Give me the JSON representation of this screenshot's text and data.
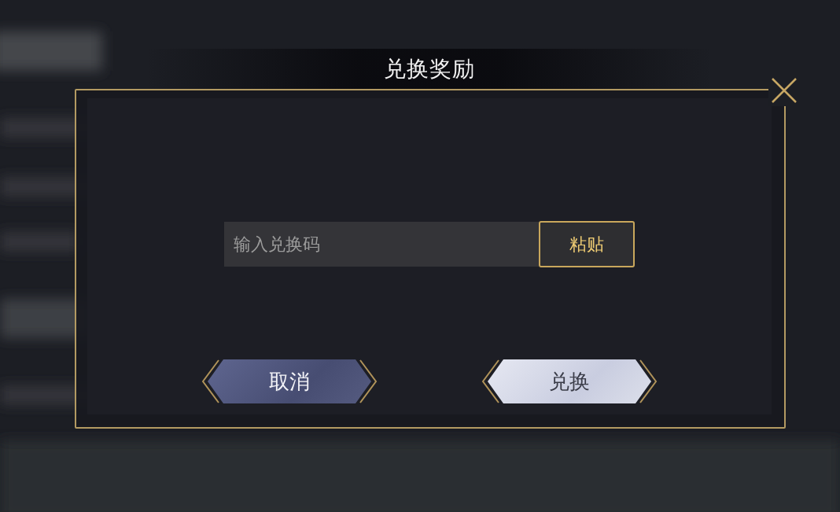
{
  "dialog": {
    "title": "兑换奖励",
    "code_field": {
      "placeholder": "输入兑换码"
    },
    "paste_button": {
      "label": "粘贴"
    },
    "buttons": [
      {
        "label": "取消",
        "kind": "secondary"
      },
      {
        "label": "兑换",
        "kind": "primary"
      }
    ]
  }
}
